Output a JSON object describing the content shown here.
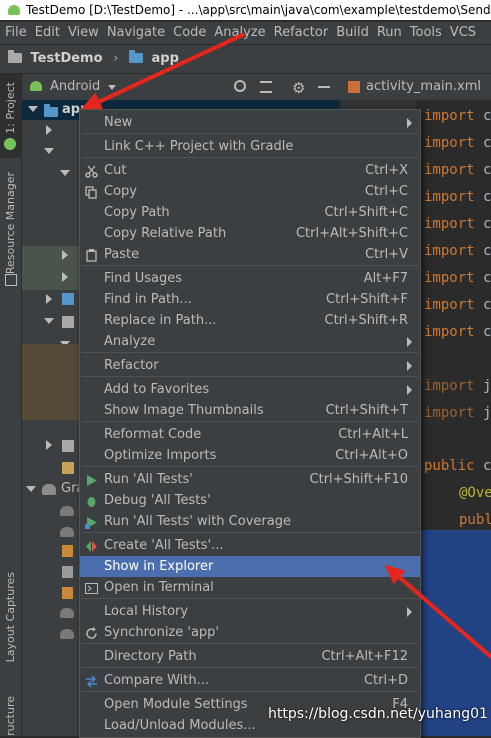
{
  "window": {
    "title": "TestDemo [D:\\TestDemo] - ...\\app\\src\\main\\java\\com\\example\\testdemo\\SendM"
  },
  "menubar": [
    "File",
    "Edit",
    "View",
    "Navigate",
    "Code",
    "Analyze",
    "Refactor",
    "Build",
    "Run",
    "Tools",
    "VCS"
  ],
  "breadcrumb": {
    "project": "TestDemo",
    "module": "app"
  },
  "left_strip": {
    "project_tab": "1: Project",
    "resource_manager_tab": "Resource Manager",
    "layout_captures_tab": "Layout Captures",
    "structure_tab": "ructure"
  },
  "project_panel": {
    "view_mode": "Android",
    "tree_root": "app",
    "gradle_label": "Gra"
  },
  "editor": {
    "tab": "activity_main.xml",
    "code_lines": [
      {
        "kw": "import",
        "rest": " c"
      },
      {
        "kw": "import",
        "rest": " c"
      },
      {
        "kw": "import",
        "rest": " c"
      },
      {
        "kw": "import",
        "rest": " c"
      },
      {
        "kw": "import",
        "rest": " c"
      },
      {
        "kw": "import",
        "rest": " c"
      },
      {
        "kw": "import",
        "rest": " c"
      },
      {
        "kw": "import",
        "rest": " c"
      },
      {
        "kw": "import",
        "rest": " c"
      },
      {
        "kw": "import",
        "rest": " j"
      },
      {
        "kw": "import",
        "rest": " j"
      },
      {
        "kw": "public",
        "rest": " c"
      },
      {
        "kw": "@Ove",
        "rest": ""
      },
      {
        "kw": "publ",
        "rest": ""
      }
    ]
  },
  "context_menu": {
    "items": [
      {
        "label": "New",
        "shortcut": "",
        "submenu": true
      },
      {
        "label": "Link C++ Project with Gradle",
        "shortcut": ""
      },
      {
        "label": "Cut",
        "shortcut": "Ctrl+X",
        "icon": "scissors-icon"
      },
      {
        "label": "Copy",
        "shortcut": "Ctrl+C",
        "icon": "copy-icon"
      },
      {
        "label": "Copy Path",
        "shortcut": "Ctrl+Shift+C"
      },
      {
        "label": "Copy Relative Path",
        "shortcut": "Ctrl+Alt+Shift+C"
      },
      {
        "label": "Paste",
        "shortcut": "Ctrl+V",
        "icon": "paste-icon"
      },
      {
        "label": "Find Usages",
        "shortcut": "Alt+F7"
      },
      {
        "label": "Find in Path...",
        "shortcut": "Ctrl+Shift+F"
      },
      {
        "label": "Replace in Path...",
        "shortcut": "Ctrl+Shift+R"
      },
      {
        "label": "Analyze",
        "shortcut": "",
        "submenu": true
      },
      {
        "label": "Refactor",
        "shortcut": "",
        "submenu": true
      },
      {
        "label": "Add to Favorites",
        "shortcut": "",
        "submenu": true
      },
      {
        "label": "Show Image Thumbnails",
        "shortcut": "Ctrl+Shift+T"
      },
      {
        "label": "Reformat Code",
        "shortcut": "Ctrl+Alt+L"
      },
      {
        "label": "Optimize Imports",
        "shortcut": "Ctrl+Alt+O"
      },
      {
        "label": "Run 'All Tests'",
        "shortcut": "Ctrl+Shift+F10",
        "icon": "run-icon"
      },
      {
        "label": "Debug 'All Tests'",
        "shortcut": "",
        "icon": "debug-icon"
      },
      {
        "label": "Run 'All Tests' with Coverage",
        "shortcut": "",
        "icon": "coverage-icon"
      },
      {
        "label": "Create 'All Tests'...",
        "shortcut": "",
        "icon": "create-test-icon"
      },
      {
        "label": "Show in Explorer",
        "shortcut": "",
        "selected": true
      },
      {
        "label": "Open in Terminal",
        "shortcut": "",
        "icon": "terminal-icon"
      },
      {
        "label": "Local History",
        "shortcut": "",
        "submenu": true
      },
      {
        "label": "Synchronize 'app'",
        "shortcut": "",
        "icon": "sync-icon"
      },
      {
        "label": "Directory Path",
        "shortcut": "Ctrl+Alt+F12"
      },
      {
        "label": "Compare With...",
        "shortcut": "Ctrl+D",
        "icon": "compare-icon"
      },
      {
        "label": "Open Module Settings",
        "shortcut": "F4"
      },
      {
        "label": "Load/Unload Modules...",
        "shortcut": ""
      }
    ]
  },
  "watermark": "https://blog.csdn.net/yuhang01",
  "colors": {
    "selection": "#4b6eaf",
    "arrow": "#e5261d",
    "keyword": "#cc7832"
  }
}
